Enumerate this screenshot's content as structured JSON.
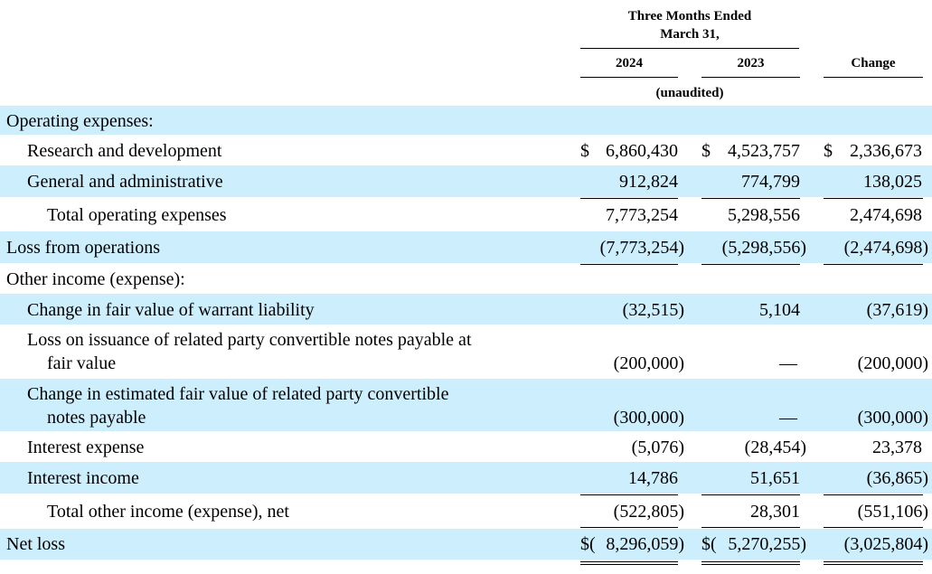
{
  "header": {
    "period_title": "Three Months Ended",
    "period_date": "March 31,",
    "year1": "2024",
    "year2": "2023",
    "change": "Change",
    "unaudited": "(unaudited)"
  },
  "currency_symbol": "$",
  "rows": {
    "operating_expenses": {
      "label": "Operating expenses:"
    },
    "research_development": {
      "label": "Research and development",
      "v2024": "6,860,430",
      "v2023": "4,523,757",
      "change": "2,336,673"
    },
    "general_admin": {
      "label": "General and administrative",
      "v2024": "912,824",
      "v2023": "774,799",
      "change": "138,025"
    },
    "total_operating": {
      "label": "Total operating expenses",
      "v2024": "7,773,254",
      "v2023": "5,298,556",
      "change": "2,474,698"
    },
    "loss_operations": {
      "label": "Loss from operations",
      "v2024": "(7,773,254)",
      "v2023": "(5,298,556)",
      "change": "(2,474,698)"
    },
    "other_income": {
      "label": "Other income (expense):"
    },
    "warrant_liability": {
      "label": "Change in fair value of warrant liability",
      "v2024": "(32,515)",
      "v2023": "5,104",
      "change": "(37,619)"
    },
    "loss_issuance": {
      "label_line1": "Loss on issuance of related party convertible notes payable at",
      "label_line2": "fair value",
      "v2024": "(200,000)",
      "v2023": "—",
      "change": "(200,000)"
    },
    "change_estimated": {
      "label_line1": "Change in estimated fair value of related party convertible",
      "label_line2": "notes payable",
      "v2024": "(300,000)",
      "v2023": "—",
      "change": "(300,000)"
    },
    "interest_expense": {
      "label": "Interest expense",
      "v2024": "(5,076)",
      "v2023": "(28,454)",
      "change": "23,378"
    },
    "interest_income": {
      "label": "Interest income",
      "v2024": "14,786",
      "v2023": "51,651",
      "change": "(36,865)"
    },
    "total_other": {
      "label": "Total other income (expense), net",
      "v2024": "(522,805)",
      "v2023": "28,301",
      "change": "(551,106)"
    },
    "net_loss": {
      "label": "Net loss",
      "v2024_prefix": "$(",
      "v2024": "8,296,059)",
      "v2023_prefix": "$(",
      "v2023": "5,270,255)",
      "change": "(3,025,804)"
    }
  }
}
